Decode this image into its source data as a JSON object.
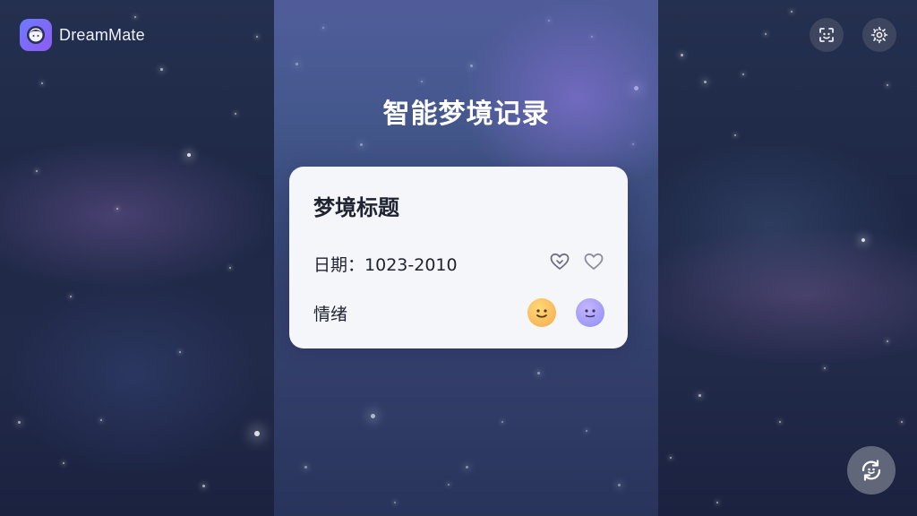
{
  "app": {
    "name": "DreamMate"
  },
  "header": {
    "face_icon": "face-scan-icon",
    "settings_icon": "settings-gear-icon"
  },
  "panel": {
    "title": "智能梦境记录"
  },
  "card": {
    "title": "梦境标题",
    "date_label": "日期：",
    "date_value": "1023-2010",
    "mood_label": "情绪",
    "date_icons": [
      "heart-icon",
      "heart-icon"
    ],
    "mood_icons": [
      "happy-emoji-icon",
      "calm-emoji-icon"
    ]
  },
  "fab": {
    "icon": "sync-face-icon"
  },
  "colors": {
    "background": "#222a4a",
    "card": "#f5f6fa",
    "brand_gradient_start": "#6d7bff",
    "brand_gradient_end": "#8e5bf0",
    "emoji_happy": "#f4a94a",
    "emoji_calm": "#8b8df0"
  }
}
